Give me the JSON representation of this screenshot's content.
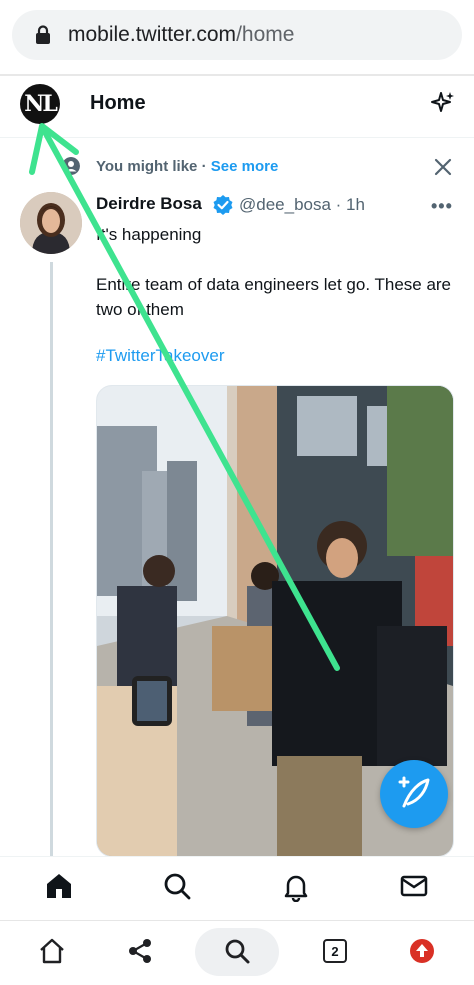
{
  "browser": {
    "url_host": "mobile.twitter.com",
    "url_path": "/home",
    "bottom_bar": {
      "tab_count": "2",
      "icons": [
        "home-icon",
        "share-icon",
        "search-icon",
        "tabs-icon",
        "update-icon"
      ]
    }
  },
  "header": {
    "avatar_initials": "NL",
    "title": "Home"
  },
  "recommendation": {
    "label": "You might like",
    "separator": " · ",
    "see_more": "See more"
  },
  "tweet": {
    "author_name": "Deirdre Bosa",
    "handle_time": "@dee_bosa · 1h",
    "text": "It's happening\n\nEntire team of data engineers let go. These are two of them",
    "hashtag": "#TwitterTakeover"
  },
  "nav": {
    "icons": [
      "home-icon",
      "search-icon",
      "bell-icon",
      "mail-icon"
    ]
  },
  "colors": {
    "accent": "#1d9bf0",
    "annotation_arrow": "#3ee38f"
  }
}
